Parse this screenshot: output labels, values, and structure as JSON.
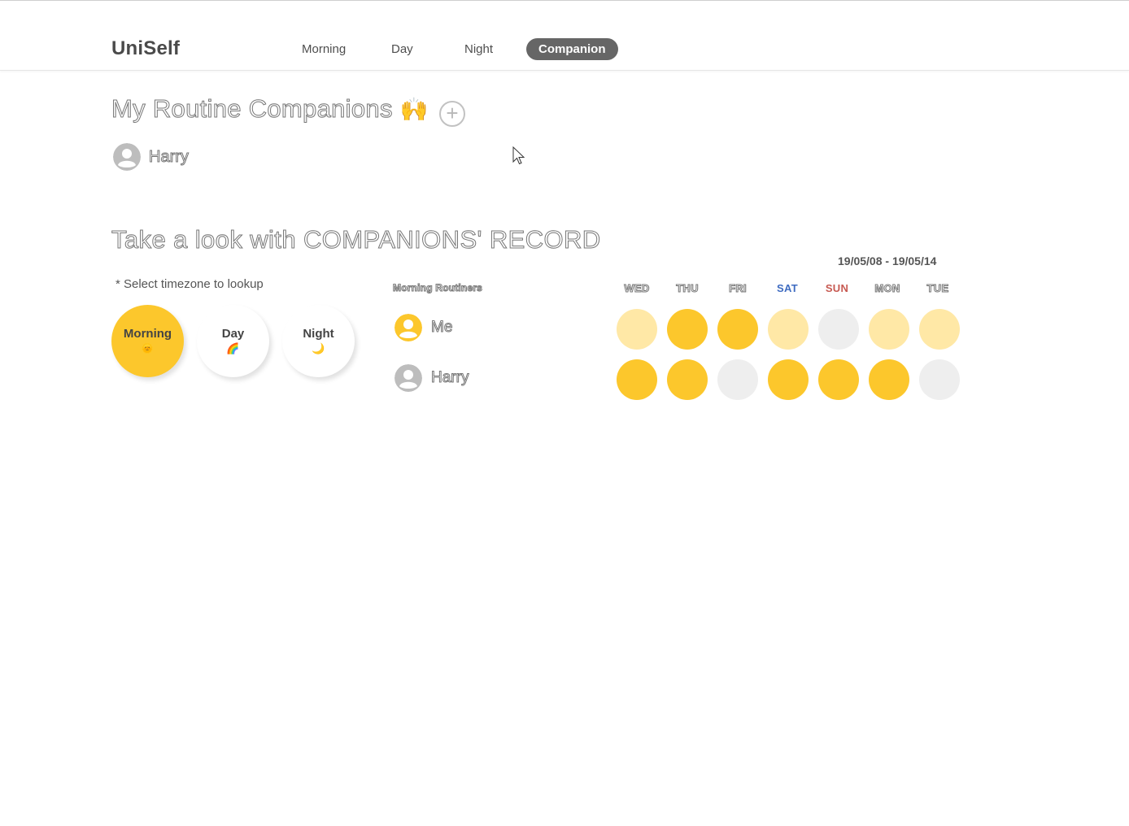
{
  "app": {
    "title": "UniSelf"
  },
  "nav": {
    "items": [
      {
        "label": "Morning"
      },
      {
        "label": "Day"
      },
      {
        "label": "Night"
      },
      {
        "label": "Companion",
        "active": true
      }
    ]
  },
  "companions": {
    "heading": "My Routine Companions",
    "heading_emoji": "🙌",
    "add_label": "+",
    "list": [
      {
        "name": "Harry"
      }
    ]
  },
  "record": {
    "heading": "Take a look with COMPANIONS' RECORD",
    "date_range": "19/05/08 - 19/05/14",
    "hint": "* Select timezone to lookup",
    "timezones": [
      {
        "label": "Morning",
        "icon": "🌞",
        "active": true
      },
      {
        "label": "Day",
        "icon": "🌈",
        "active": false
      },
      {
        "label": "Night",
        "icon": "🌙",
        "active": false
      }
    ],
    "list_title": "Morning Routiners",
    "days": [
      "WED",
      "THU",
      "FRI",
      "SAT",
      "SUN",
      "MON",
      "TUE"
    ],
    "rows": [
      {
        "name": "Me",
        "levels": [
          "partial",
          "full",
          "full",
          "partial",
          "none",
          "partial",
          "partial"
        ]
      },
      {
        "name": "Harry",
        "levels": [
          "full",
          "full",
          "none",
          "full",
          "full",
          "full",
          "none"
        ]
      }
    ]
  },
  "colors": {
    "accent": "#fcc72c",
    "accent_light": "#ffe8a6",
    "empty": "#eeeeee",
    "nav_active": "#666666",
    "saturday": "#3f6cc1",
    "sunday": "#c75a52"
  }
}
